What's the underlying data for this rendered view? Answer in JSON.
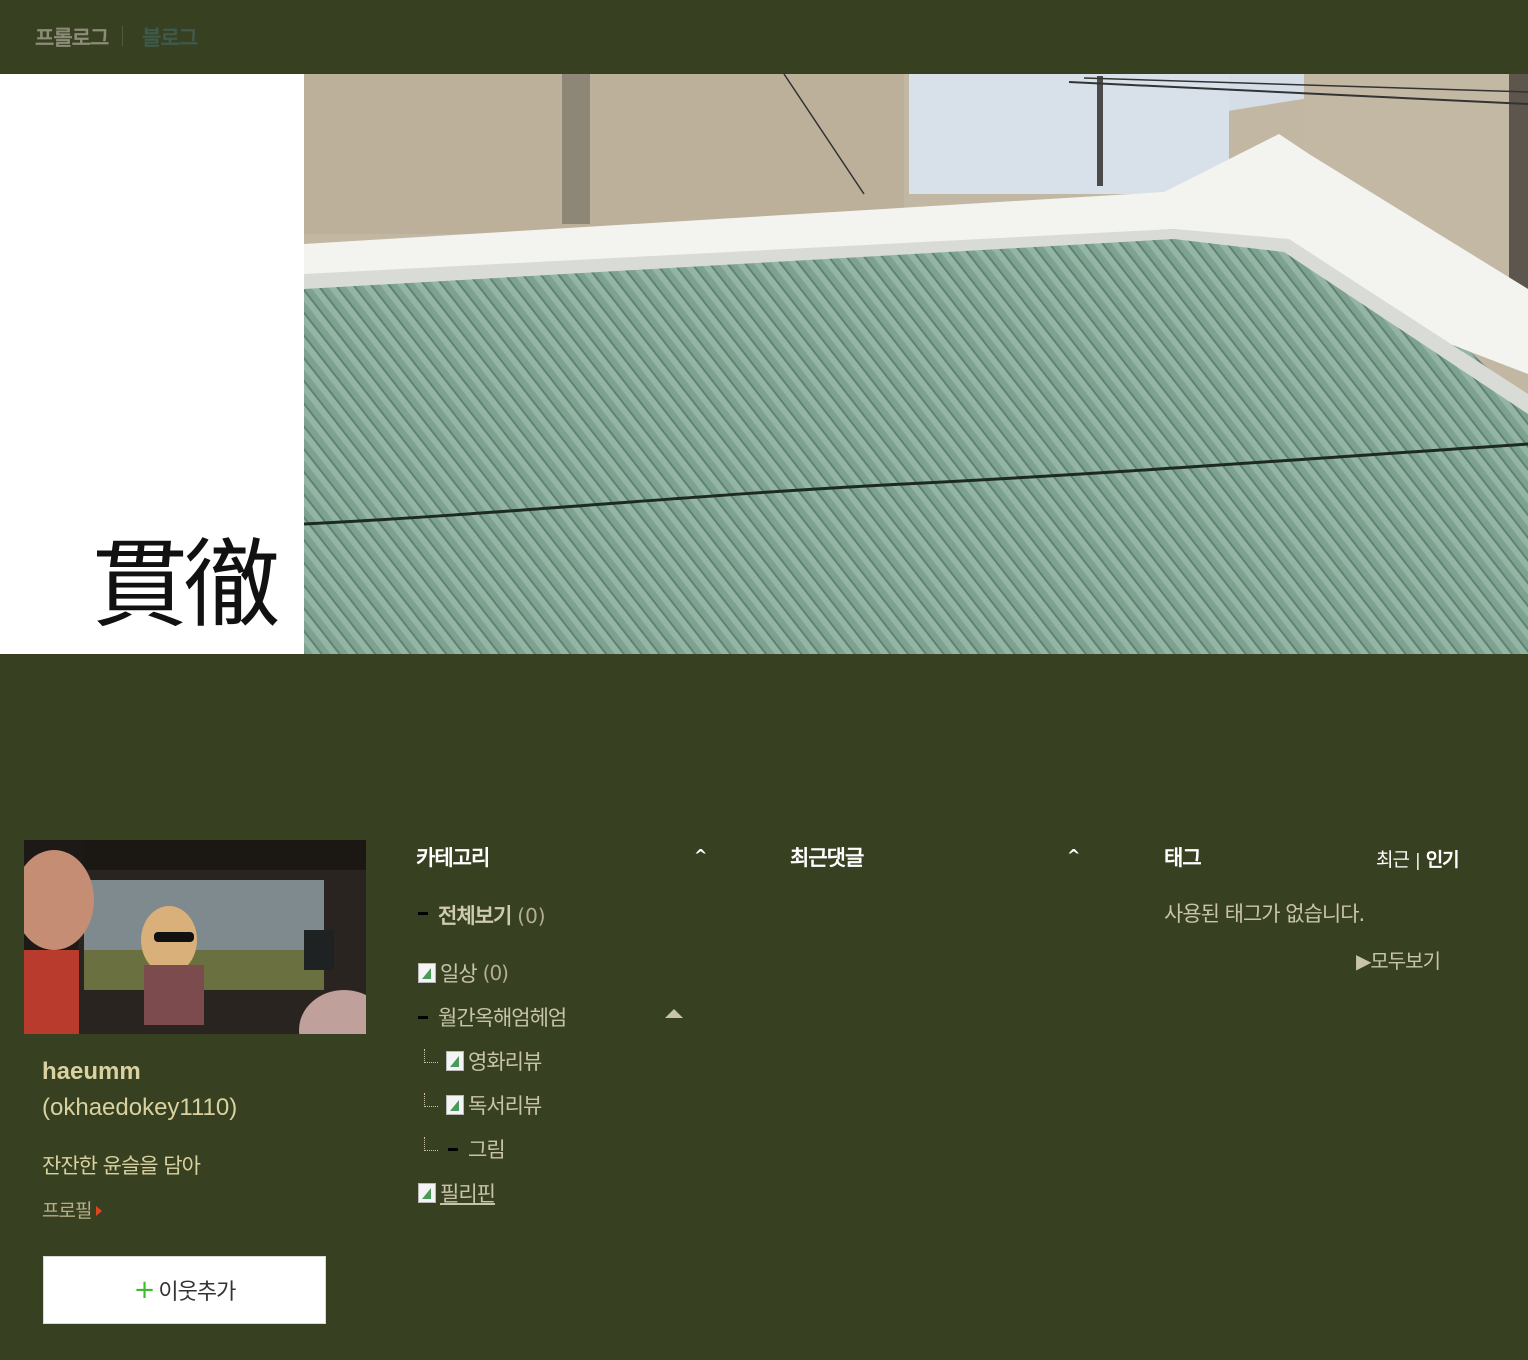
{
  "nav": {
    "prologue": "프롤로그",
    "blog": "블로그"
  },
  "banner": {
    "calligraphy": "貫徹"
  },
  "profile": {
    "nickname": "haeumm",
    "blog_id": "(okhaedokey1110)",
    "description": "잔잔한 윤슬을 담아",
    "profile_link": "프로필",
    "add_neighbor": "이웃추가"
  },
  "category": {
    "title": "카테고리",
    "caret": "^",
    "all_label": "전체보기",
    "all_count": "(0)",
    "items": [
      {
        "label": "일상",
        "count": "(0)",
        "icon": "doc-icon"
      },
      {
        "label": "월간옥해엄헤엄",
        "icon": "dash-icon"
      },
      {
        "label": "영화리뷰",
        "icon": "doc-icon"
      },
      {
        "label": "독서리뷰",
        "icon": "doc-icon"
      },
      {
        "label": "그림",
        "icon": "dash-icon"
      },
      {
        "label": "필리핀",
        "icon": "doc-icon"
      }
    ]
  },
  "comments": {
    "title": "최근댓글",
    "caret": "^"
  },
  "tags": {
    "title": "태그",
    "sort_recent": "최근",
    "sort_sep": "|",
    "sort_popular": "인기",
    "empty": "사용된 태그가 없습니다.",
    "view_all": "▶모두보기"
  },
  "colors": {
    "background": "#384022",
    "accent_text": "#d9d2a0",
    "arrow": "#e0461e",
    "plus": "#3dbb2c"
  }
}
